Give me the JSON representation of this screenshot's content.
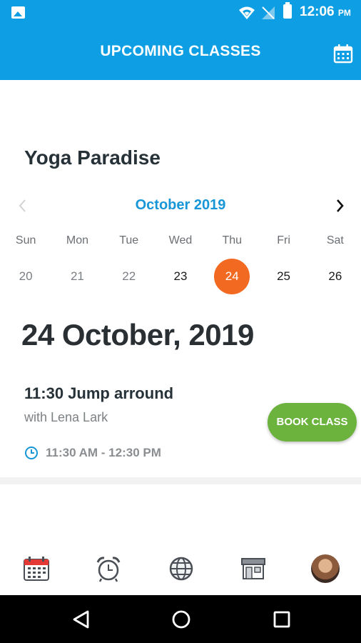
{
  "status_bar": {
    "time": "12:06",
    "ampm": "PM"
  },
  "app_bar": {
    "title": "UPCOMING CLASSES"
  },
  "studio": {
    "name": "Yoga Paradise"
  },
  "calendar": {
    "month_label": "October 2019",
    "weekdays": [
      "Sun",
      "Mon",
      "Tue",
      "Wed",
      "Thu",
      "Fri",
      "Sat"
    ],
    "days": [
      "20",
      "21",
      "22",
      "23",
      "24",
      "25",
      "26"
    ],
    "selected_day": "24"
  },
  "selected_date_label": "24 October, 2019",
  "class": {
    "title": "11:30 Jump arround",
    "instructor": "with Lena Lark",
    "time_range": "11:30 AM - 12:30 PM",
    "book_label": "BOOK CLASS"
  },
  "colors": {
    "primary": "#0d9ee3",
    "accent": "#f26a21",
    "book": "#6cb33e",
    "month": "#1796d8"
  },
  "bottom_nav": [
    "calendar-icon",
    "alarm-clock-icon",
    "globe-icon",
    "store-icon",
    "profile-avatar"
  ]
}
